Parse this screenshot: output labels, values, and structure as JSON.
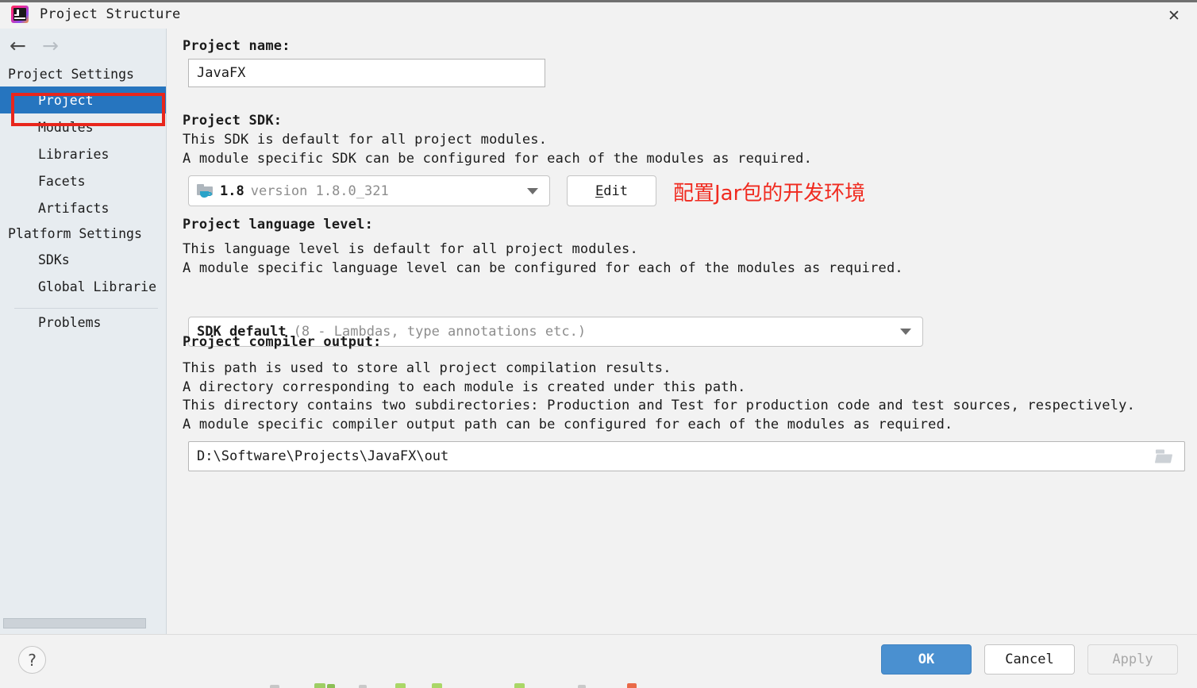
{
  "window": {
    "title": "Project Structure",
    "app_icon": "intellij-idea-icon",
    "close_icon": "close-icon"
  },
  "sidebar": {
    "nav_back_icon": "arrow-left-icon",
    "nav_forward_icon": "arrow-right-icon",
    "groups": [
      {
        "header": "Project Settings",
        "items": [
          {
            "label": "Project",
            "selected": true
          },
          {
            "label": "Modules",
            "selected": false
          },
          {
            "label": "Libraries",
            "selected": false
          },
          {
            "label": "Facets",
            "selected": false
          },
          {
            "label": "Artifacts",
            "selected": false
          }
        ]
      },
      {
        "header": "Platform Settings",
        "items": [
          {
            "label": "SDKs",
            "selected": false
          },
          {
            "label": "Global Librarie",
            "selected": false
          }
        ]
      }
    ],
    "footer_items": [
      {
        "label": "Problems",
        "selected": false
      }
    ]
  },
  "main": {
    "project_name": {
      "label": "Project name:",
      "value": "JavaFX"
    },
    "project_sdk": {
      "label": "Project SDK:",
      "desc_line1": "This SDK is default for all project modules.",
      "desc_line2": "A module specific SDK can be configured for each of the modules as required.",
      "sdk_icon": "java-sdk-folder-icon",
      "value_strong": "1.8",
      "value_dim": "version 1.8.0_321",
      "dropdown_icon": "chevron-down-icon",
      "edit_button": "Edit",
      "edit_mnemonic": "E",
      "edit_rest": "dit"
    },
    "language_level": {
      "label": "Project language level:",
      "desc_line1": "This language level is default for all project modules.",
      "desc_line2": "A module specific language level can be configured for each of the modules as required.",
      "value_strong": "SDK default",
      "value_dim": "(8 - Lambdas, type annotations etc.)",
      "dropdown_icon": "chevron-down-icon"
    },
    "compiler_output": {
      "label": "Project compiler output:",
      "desc_line1": "This path is used to store all project compilation results.",
      "desc_line2": "A directory corresponding to each module is created under this path.",
      "desc_line3": "This directory contains two subdirectories: Production and Test for production code and test sources, respectively.",
      "desc_line4": "A module specific compiler output path can be configured for each of the modules as required.",
      "value": "D:\\Software\\Projects\\JavaFX\\out",
      "browse_icon": "folder-browse-icon"
    }
  },
  "annotations": {
    "color": "#e8261c",
    "sdk_note": "配置Jar包的开发环境",
    "boxes": [
      "project-sidebar-item",
      "project-sdk-combo"
    ]
  },
  "footer": {
    "help_icon": "question-mark-icon",
    "help_label": "?",
    "buttons": [
      {
        "label": "OK",
        "style": "primary",
        "enabled": true
      },
      {
        "label": "Cancel",
        "style": "normal",
        "enabled": true
      },
      {
        "label": "Apply",
        "style": "disabled",
        "enabled": false
      }
    ]
  }
}
